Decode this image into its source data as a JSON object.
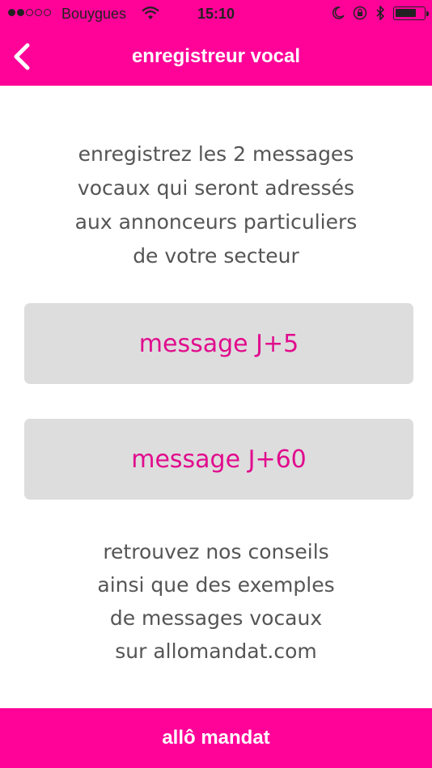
{
  "status_bar": {
    "carrier": "Bouygues",
    "time": "15:10",
    "signal_bars_filled": 2,
    "signal_bars_total": 5,
    "battery_level": 0.75
  },
  "nav": {
    "title": "enregistreur vocal",
    "back_icon": "chevron-left-icon"
  },
  "intro": {
    "text": "enregistrez les 2 messages\nvocaux qui seront adressés\naux annonceurs particuliers\nde votre secteur"
  },
  "buttons": {
    "message_j5": "message J+5",
    "message_j60": "message J+60"
  },
  "advice": {
    "text": "retrouvez nos conseils\nainsi que des exemples\nde messages vocaux\nsur allomandat.com"
  },
  "footer": {
    "label": "allô mandat"
  },
  "colors": {
    "brand_pink": "#ff0399",
    "button_text_pink": "#e10b8d",
    "button_bg": "#dddddd",
    "body_text": "#555555"
  }
}
